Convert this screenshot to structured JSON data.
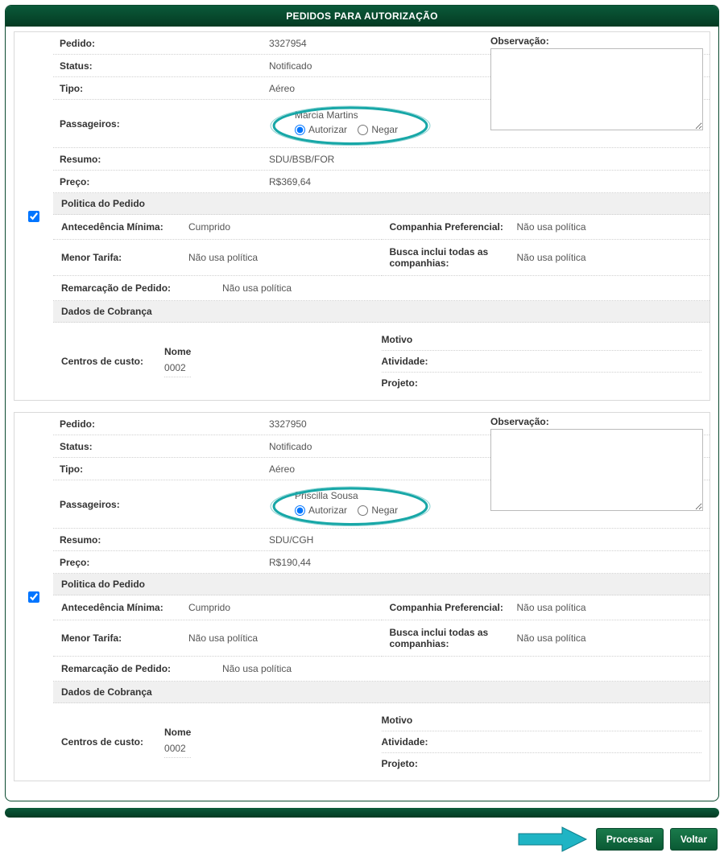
{
  "header": {
    "title": "PEDIDOS PARA AUTORIZAÇÃO"
  },
  "labels": {
    "pedido": "Pedido:",
    "status": "Status:",
    "tipo": "Tipo:",
    "passageiros": "Passageiros:",
    "resumo": "Resumo:",
    "preco": "Preço:",
    "observacao": "Observação:",
    "politica": "Politica do Pedido",
    "antecedencia": "Antecedência Mínima:",
    "companhiaPref": "Companhia Preferencial:",
    "menorTarifa": "Menor Tarifa:",
    "buscaInclui": "Busca inclui todas as companhias:",
    "remarcacao": "Remarcação de Pedido:",
    "dadosCobranca": "Dados de Cobrança",
    "centrosCusto": "Centros de custo:",
    "nome": "Nome",
    "motivo": "Motivo",
    "atividade": "Atividade:",
    "projeto": "Projeto:",
    "autorizar": "Autorizar",
    "negar": "Negar"
  },
  "pedidos": [
    {
      "num": "3327954",
      "status": "Notificado",
      "tipo": "Aéreo",
      "passageiro": "Marcia Martins",
      "resumo": "SDU/BSB/FOR",
      "preco": "R$369,64",
      "antecedencia": "Cumprido",
      "companhiaPref": "Não usa política",
      "menorTarifa": "Não usa política",
      "buscaInclui": "Não usa política",
      "remarcacao": "Não usa política",
      "centroCusto": "0002"
    },
    {
      "num": "3327950",
      "status": "Notificado",
      "tipo": "Aéreo",
      "passageiro": "Priscilla Sousa",
      "resumo": "SDU/CGH",
      "preco": "R$190,44",
      "antecedencia": "Cumprido",
      "companhiaPref": "Não usa política",
      "menorTarifa": "Não usa política",
      "buscaInclui": "Não usa política",
      "remarcacao": "Não usa política",
      "centroCusto": "0002"
    }
  ],
  "actions": {
    "processar": "Processar",
    "voltar": "Voltar"
  }
}
